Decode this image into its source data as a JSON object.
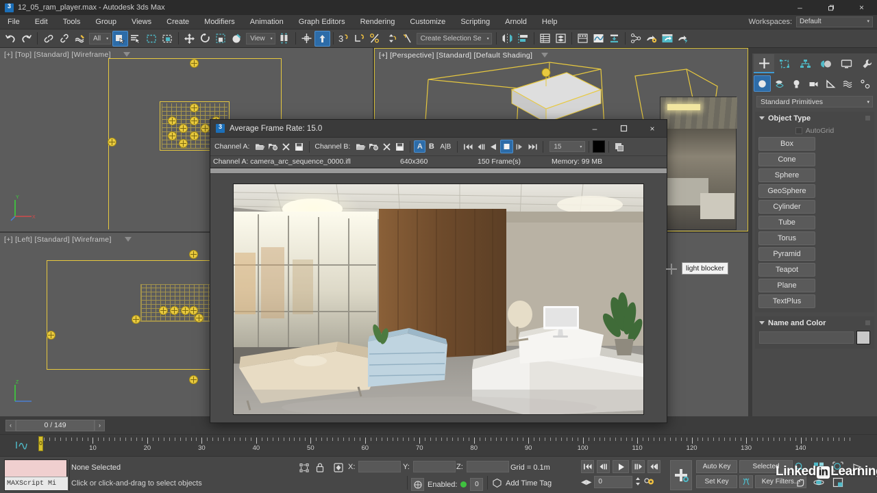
{
  "window": {
    "title": "12_05_ram_player.max - Autodesk 3ds Max",
    "minimize": "–",
    "maximize": "❐",
    "close": "×"
  },
  "menu": {
    "items": [
      "File",
      "Edit",
      "Tools",
      "Group",
      "Views",
      "Create",
      "Modifiers",
      "Animation",
      "Graph Editors",
      "Rendering",
      "Customize",
      "Scripting",
      "Arnold",
      "Help"
    ],
    "workspaces_label": "Workspaces:",
    "workspace_value": "Default"
  },
  "toolbar": {
    "selection_filter": "All",
    "reference_coord": "View",
    "selection_set": "Create Selection Se",
    "caret": "▾"
  },
  "viewports": [
    {
      "label": "[+] [Top] [Standard] [Wireframe]",
      "name": "viewport-top"
    },
    {
      "label": "[+] [Perspective] [Standard] [Default Shading]",
      "name": "viewport-perspective"
    },
    {
      "label": "[+] [Left] [Standard] [Wireframe]",
      "name": "viewport-left"
    },
    {
      "label": "",
      "name": "viewport-front"
    }
  ],
  "tooltip": {
    "text": "light blocker"
  },
  "ram_player": {
    "title": "Average Frame Rate: 15.0",
    "minimize": "–",
    "maximize": "☐",
    "close": "×",
    "channel_a_label": "Channel A:",
    "channel_b_label": "Channel B:",
    "toggle_a": "A",
    "toggle_b": "B",
    "toggle_ab": "A|B",
    "fps_value": "15",
    "caret": "▾",
    "info": {
      "channel": "Channel A: camera_arc_sequence_0000.ifl",
      "resolution": "640x360",
      "frames": "150 Frame(s)",
      "memory": "Memory: 99 MB"
    },
    "buttons": {
      "open": "open-icon",
      "grab": "grab-viewport-icon",
      "close_channel": "close-channel-icon",
      "save": "save-icon",
      "first": "⏮",
      "prev": "◁|",
      "play_back": "◀",
      "stop": "■",
      "play": "|▷",
      "last": "⏭"
    }
  },
  "command_panel": {
    "tabs": [
      "create-tab",
      "modify-tab",
      "hierarchy-tab",
      "motion-tab",
      "display-tab",
      "utilities-tab"
    ],
    "subtabs": [
      "geometry-subtab",
      "shapes-subtab",
      "lights-subtab",
      "cameras-subtab",
      "helpers-subtab",
      "space-warps-subtab",
      "systems-subtab"
    ],
    "category": "Standard Primitives",
    "object_type_header": "Object Type",
    "autogrid_label": "AutoGrid",
    "object_buttons": [
      "Box",
      "Cone",
      "Sphere",
      "GeoSphere",
      "Cylinder",
      "Tube",
      "Torus",
      "Pyramid",
      "Teapot",
      "Plane",
      "TextPlus"
    ],
    "name_color_header": "Name and Color",
    "name_value": "",
    "color_swatch": "#c8c8c8",
    "caret": "▾"
  },
  "time_slider": {
    "prev_label": "‹",
    "next_label": "›",
    "value": "0 / 149"
  },
  "track_bar": {
    "labels": [
      "10",
      "20",
      "30",
      "40",
      "50",
      "60",
      "70",
      "80",
      "90",
      "100",
      "110",
      "120",
      "130",
      "140"
    ],
    "playhead_label": "0",
    "start": 0,
    "end": 150
  },
  "status_bar": {
    "mxs_listener_label": "MAXScript Mi",
    "selection": "None Selected",
    "hint": "Click or click-and-drag to select objects",
    "x_label": "X:",
    "x_value": "",
    "y_label": "Y:",
    "y_value": "",
    "z_label": "Z:",
    "z_value": "",
    "grid": "Grid = 0.1m",
    "enabled_label": "Enabled:",
    "enabled_value": "0",
    "add_time_tag": "Add Time Tag",
    "frame_value": "0",
    "auto_key": "Auto Key",
    "set_key": "Set Key",
    "selected": "Selected",
    "key_filters": "Key Filters...",
    "playback": {
      "first": "|◀◀",
      "prev": "◀||",
      "play": "▶",
      "next": "||▶",
      "last": "▶▶|"
    }
  },
  "watermark": {
    "pre": "Linked",
    "box": "in",
    "post": "Learning"
  },
  "colors": {
    "accent": "#2d6ca8",
    "wire_yellow": "#e8c93f",
    "teal": "#4fb9c7",
    "panel": "#4a4a4a",
    "viewport": "#5c5c5c"
  }
}
